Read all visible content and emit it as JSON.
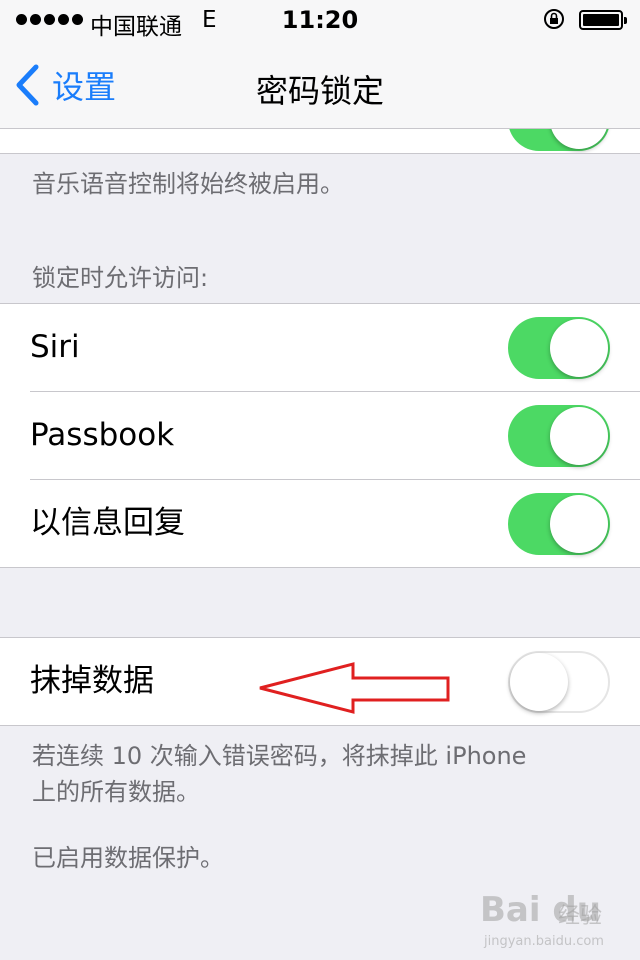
{
  "status_bar": {
    "carrier": "中国联通",
    "network": "E",
    "time": "11:20"
  },
  "nav": {
    "back_label": "设置",
    "title": "密码锁定"
  },
  "voice_control_note": "音乐语音控制将始终被启用。",
  "allow_access_header": "锁定时允许访问:",
  "allow_access_items": [
    {
      "label": "Siri",
      "on": true
    },
    {
      "label": "Passbook",
      "on": true
    },
    {
      "label": "以信息回复",
      "on": true
    }
  ],
  "erase_data": {
    "label": "抹掉数据",
    "on": false
  },
  "erase_note_line1": "若连续 10 次输入错误密码，将抹掉此 iPhone",
  "erase_note_line2": "上的所有数据。",
  "data_protection_note": "已启用数据保护。",
  "watermark": {
    "main": "Bai du",
    "sub": "经验",
    "url": "jingyan.baidu.com"
  },
  "colors": {
    "accent": "#1a7dfb",
    "toggle_on": "#4cd964",
    "annotation_arrow": "#e02020"
  }
}
